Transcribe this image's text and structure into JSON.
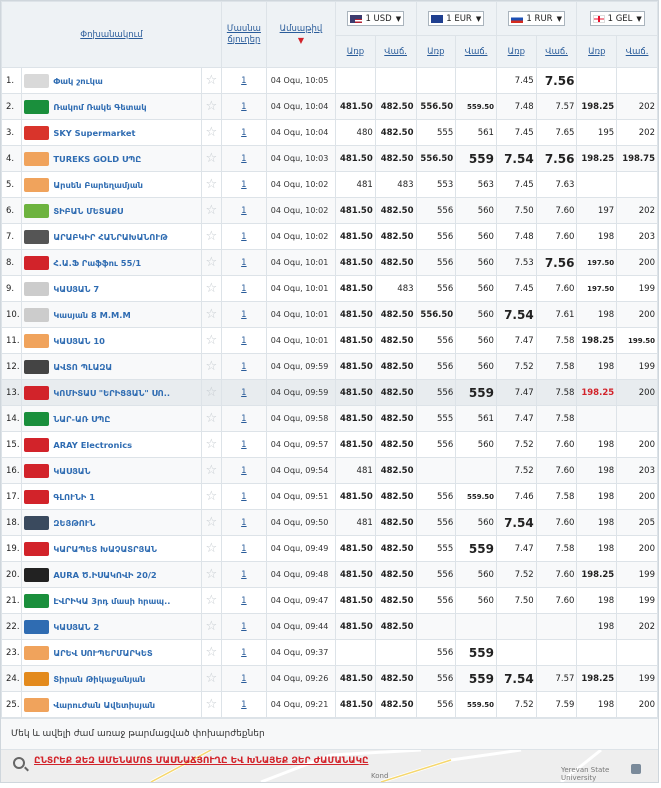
{
  "header": {
    "exchange_point": "Փոխանակում",
    "branches": "Մասնա ճյուղեր",
    "date": "Ամսաթիվ",
    "buy": "Առք",
    "sell": "Վաճ.",
    "currencies": [
      {
        "label": "1 USD",
        "flag": "us-flag-icon"
      },
      {
        "label": "1 EUR",
        "flag": "eu-flag-icon"
      },
      {
        "label": "1 RUR",
        "flag": "ru-flag-icon"
      },
      {
        "label": "1 GEL",
        "flag": "ge-flag-icon"
      }
    ]
  },
  "rows": [
    {
      "n": "1.",
      "name": "Փակ շուկա",
      "logo": "#d9d9d9",
      "branches": "1",
      "date": "04 Օգս, 10:05",
      "usd_b": "",
      "usd_s": "",
      "eur_b": "",
      "eur_s": "",
      "rur_b": "7.45",
      "rur_s": "7.56",
      "gel_b": "",
      "gel_s": ""
    },
    {
      "n": "2.",
      "name": "Ռակոմ Ռակե Գետակ",
      "logo": "#1a8f3c",
      "branches": "1",
      "date": "04 Օգս, 10:04",
      "usd_b": "481.50",
      "usd_s": "482.50",
      "eur_b": "556.50",
      "eur_s": "559.50",
      "rur_b": "7.48",
      "rur_s": "7.57",
      "gel_b": "198.25",
      "gel_s": "202"
    },
    {
      "n": "3.",
      "name": "SKY Supermarket",
      "logo": "#d9342b",
      "branches": "1",
      "date": "04 Օգս, 10:04",
      "usd_b": "480",
      "usd_s": "482.50",
      "eur_b": "555",
      "eur_s": "561",
      "rur_b": "7.45",
      "rur_s": "7.65",
      "gel_b": "195",
      "gel_s": "202"
    },
    {
      "n": "4.",
      "name": "TUREKS GOLD ՍՊԸ",
      "logo": "#f0a35c",
      "branches": "1",
      "date": "04 Օգս, 10:03",
      "usd_b": "481.50",
      "usd_s": "482.50",
      "eur_b": "556.50",
      "eur_s": "559",
      "rur_b": "7.54",
      "rur_s": "7.56",
      "gel_b": "198.25",
      "gel_s": "198.75"
    },
    {
      "n": "5.",
      "name": "Արսեն Բարեղամյան",
      "logo": "#f0a35c",
      "branches": "1",
      "date": "04 Օգս, 10:02",
      "usd_b": "481",
      "usd_s": "483",
      "eur_b": "553",
      "eur_s": "563",
      "rur_b": "7.45",
      "rur_s": "7.63",
      "gel_b": "",
      "gel_s": ""
    },
    {
      "n": "6.",
      "name": "ՏԻԲԱՆ ՄԵՏԱՔՍ",
      "logo": "#6db33f",
      "branches": "1",
      "date": "04 Օգս, 10:02",
      "usd_b": "481.50",
      "usd_s": "482.50",
      "eur_b": "556",
      "eur_s": "560",
      "rur_b": "7.50",
      "rur_s": "7.60",
      "gel_b": "197",
      "gel_s": "202"
    },
    {
      "n": "7.",
      "name": "ԱՐԱԲԿԻՐ ՀԱՆՐԱԽԱՆՈՒԹ",
      "logo": "#555555",
      "branches": "1",
      "date": "04 Օգս, 10:02",
      "usd_b": "481.50",
      "usd_s": "482.50",
      "eur_b": "556",
      "eur_s": "560",
      "rur_b": "7.48",
      "rur_s": "7.60",
      "gel_b": "198",
      "gel_s": "203"
    },
    {
      "n": "8.",
      "name": "Հ.Ա.Ֆ Րաֆֆու 55/1",
      "logo": "#d2232a",
      "branches": "1",
      "date": "04 Օգս, 10:01",
      "usd_b": "481.50",
      "usd_s": "482.50",
      "eur_b": "556",
      "eur_s": "560",
      "rur_b": "7.53",
      "rur_s": "7.56",
      "gel_b": "197.50",
      "gel_s": "200"
    },
    {
      "n": "9.",
      "name": "ԿԱՍՅԱՆ 7",
      "logo": "#cccccc",
      "branches": "1",
      "date": "04 Օգս, 10:01",
      "usd_b": "481.50",
      "usd_s": "483",
      "eur_b": "556",
      "eur_s": "560",
      "rur_b": "7.45",
      "rur_s": "7.60",
      "gel_b": "197.50",
      "gel_s": "199"
    },
    {
      "n": "10.",
      "name": "Կասյան 8 M.M.M",
      "logo": "#cccccc",
      "branches": "1",
      "date": "04 Օգս, 10:01",
      "usd_b": "481.50",
      "usd_s": "482.50",
      "eur_b": "556.50",
      "eur_s": "560",
      "rur_b": "7.54",
      "rur_s": "7.61",
      "gel_b": "198",
      "gel_s": "200"
    },
    {
      "n": "11.",
      "name": "ԿԱՍՅԱՆ 10",
      "logo": "#f0a35c",
      "branches": "1",
      "date": "04 Օգս, 10:01",
      "usd_b": "481.50",
      "usd_s": "482.50",
      "eur_b": "556",
      "eur_s": "560",
      "rur_b": "7.47",
      "rur_s": "7.58",
      "gel_b": "198.25",
      "gel_s": "199.50"
    },
    {
      "n": "12.",
      "name": "ԱՎՏՈ ՊԼԱԶԱ",
      "logo": "#444444",
      "branches": "1",
      "date": "04 Օգս, 09:59",
      "usd_b": "481.50",
      "usd_s": "482.50",
      "eur_b": "556",
      "eur_s": "560",
      "rur_b": "7.52",
      "rur_s": "7.58",
      "gel_b": "198",
      "gel_s": "199"
    },
    {
      "n": "13.",
      "name": "ԿՈՄԻՏԱՍ \"ԵՐԻՑՅԱՆ\" ՍՈ..",
      "logo": "#d2232a",
      "branches": "1",
      "date": "04 Օգս, 09:59",
      "usd_b": "481.50",
      "usd_s": "482.50",
      "eur_b": "556",
      "eur_s": "559",
      "rur_b": "7.47",
      "rur_s": "7.58",
      "gel_b": "198.25",
      "gel_s": "200"
    },
    {
      "n": "14.",
      "name": "ՆԱՐ-ԱՌ ՍՊԸ",
      "logo": "#1a8f3c",
      "branches": "1",
      "date": "04 Օգս, 09:58",
      "usd_b": "481.50",
      "usd_s": "482.50",
      "eur_b": "555",
      "eur_s": "561",
      "rur_b": "7.47",
      "rur_s": "7.58",
      "gel_b": "",
      "gel_s": ""
    },
    {
      "n": "15.",
      "name": "ARAY Electronics",
      "logo": "#d2232a",
      "branches": "1",
      "date": "04 Օգս, 09:57",
      "usd_b": "481.50",
      "usd_s": "482.50",
      "eur_b": "556",
      "eur_s": "560",
      "rur_b": "7.52",
      "rur_s": "7.60",
      "gel_b": "198",
      "gel_s": "200"
    },
    {
      "n": "16.",
      "name": "ԿԱՍՅԱՆ",
      "logo": "#d2232a",
      "branches": "1",
      "date": "04 Օգս, 09:54",
      "usd_b": "481",
      "usd_s": "482.50",
      "eur_b": "",
      "eur_s": "",
      "rur_b": "7.52",
      "rur_s": "7.60",
      "gel_b": "198",
      "gel_s": "203"
    },
    {
      "n": "17.",
      "name": "ԳԼՈՒՆԻ 1",
      "logo": "#d2232a",
      "branches": "1",
      "date": "04 Օգս, 09:51",
      "usd_b": "481.50",
      "usd_s": "482.50",
      "eur_b": "556",
      "eur_s": "559.50",
      "rur_b": "7.46",
      "rur_s": "7.58",
      "gel_b": "198",
      "gel_s": "200"
    },
    {
      "n": "18.",
      "name": "ԶԵՅԹՈՒՆ",
      "logo": "#3a4a5e",
      "branches": "1",
      "date": "04 Օգս, 09:50",
      "usd_b": "481",
      "usd_s": "482.50",
      "eur_b": "556",
      "eur_s": "560",
      "rur_b": "7.54",
      "rur_s": "7.60",
      "gel_b": "198",
      "gel_s": "205"
    },
    {
      "n": "19.",
      "name": "ԿԱՐԱՊԵՏ ԽԱՉԱՏՐՅԱՆ",
      "logo": "#d2232a",
      "branches": "1",
      "date": "04 Օգս, 09:49",
      "usd_b": "481.50",
      "usd_s": "482.50",
      "eur_b": "555",
      "eur_s": "559",
      "rur_b": "7.47",
      "rur_s": "7.58",
      "gel_b": "198",
      "gel_s": "200"
    },
    {
      "n": "20.",
      "name": "AURA Ծ.ԻՍԱԿՈՎԻ 20/2",
      "logo": "#222222",
      "branches": "1",
      "date": "04 Օգս, 09:48",
      "usd_b": "481.50",
      "usd_s": "482.50",
      "eur_b": "556",
      "eur_s": "560",
      "rur_b": "7.52",
      "rur_s": "7.60",
      "gel_b": "198.25",
      "gel_s": "199"
    },
    {
      "n": "21.",
      "name": "ԷՎՐԻԿԱ 3րդ մասի հրապ..",
      "logo": "#1a8f3c",
      "branches": "1",
      "date": "04 Օգս, 09:47",
      "usd_b": "481.50",
      "usd_s": "482.50",
      "eur_b": "556",
      "eur_s": "560",
      "rur_b": "7.50",
      "rur_s": "7.60",
      "gel_b": "198",
      "gel_s": "199"
    },
    {
      "n": "22.",
      "name": "ԿԱՍՅԱՆ 2",
      "logo": "#2f6cb2",
      "branches": "1",
      "date": "04 Օգս, 09:44",
      "usd_b": "481.50",
      "usd_s": "482.50",
      "eur_b": "",
      "eur_s": "",
      "rur_b": "",
      "rur_s": "",
      "gel_b": "198",
      "gel_s": "202"
    },
    {
      "n": "23.",
      "name": "ԱՐԵՎ ՍՈՒՊԵՐՄԱՐԿԵՏ",
      "logo": "#f0a35c",
      "branches": "1",
      "date": "04 Օգս, 09:37",
      "usd_b": "",
      "usd_s": "",
      "eur_b": "556",
      "eur_s": "559",
      "rur_b": "",
      "rur_s": "",
      "gel_b": "",
      "gel_s": ""
    },
    {
      "n": "24.",
      "name": "Տիրան Թիկաջանյան",
      "logo": "#e38a1d",
      "branches": "1",
      "date": "04 Օգս, 09:26",
      "usd_b": "481.50",
      "usd_s": "482.50",
      "eur_b": "556",
      "eur_s": "559",
      "rur_b": "7.54",
      "rur_s": "7.57",
      "gel_b": "198.25",
      "gel_s": "199"
    },
    {
      "n": "25.",
      "name": "Վարուժան Ավետիսյան",
      "logo": "#f0a35c",
      "branches": "1",
      "date": "04 Օգս, 09:21",
      "usd_b": "481.50",
      "usd_s": "482.50",
      "eur_b": "556",
      "eur_s": "559.50",
      "rur_b": "7.52",
      "rur_s": "7.59",
      "gel_b": "198",
      "gel_s": "200"
    }
  ],
  "footer": {
    "note": "Մեկ և ավելի ժամ առաջ թարմացված փոխարժեքներ",
    "map_link": "ԸՆՏՐԵՔ ՁԵԶ ԱՄԵՆԱՄՈՏ ՄԱՍՆԱՃՅՈՒՂԸ ԵՎ ԽՆԱՅԵՔ ՁԵՐ ԺԱՄԱՆԱԿԸ",
    "map_label1": "Kond",
    "map_label2": "Yerevan State University"
  },
  "colors": {
    "accent": "#2a5c9a",
    "highlight_red": "#d2232a"
  },
  "highlighted_row": 13
}
